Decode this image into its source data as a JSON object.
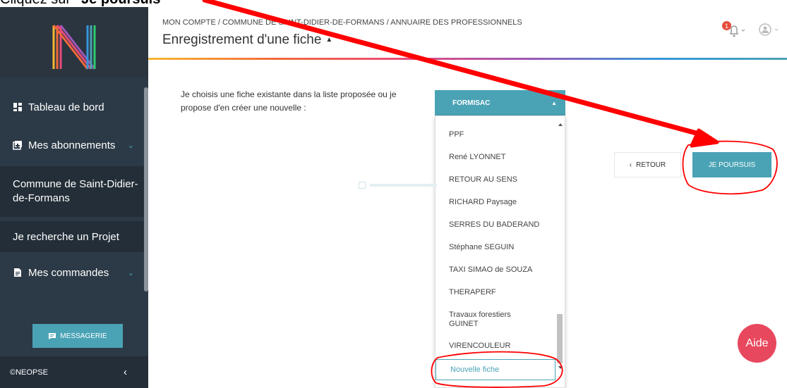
{
  "caption": {
    "prefix": "Cliquez sur ",
    "bold": "\"Je poursuis\""
  },
  "sidebar": {
    "items": [
      {
        "label": "Tableau de bord",
        "icon": "dashboard-icon"
      },
      {
        "label": "Mes abonnements",
        "icon": "subscriptions-icon"
      },
      {
        "label": "Commune de Saint-Didier-de-Formans"
      },
      {
        "label": "Je recherche un Projet"
      },
      {
        "label": "Mes commandes",
        "icon": "document-icon"
      }
    ],
    "messagerie_label": "MESSAGERIE",
    "footer_label": "©NEOPSE"
  },
  "header": {
    "breadcrumb": "MON COMPTE / COMMUNE DE SAINT-DIDIER-DE-FORMANS / ANNUAIRE DES PROFESSIONNELS",
    "title": "Enregistrement d'une fiche",
    "notification_count": "1"
  },
  "form": {
    "question": "Je choisis une fiche existante dans la liste proposée ou je propose d'en créer une nouvelle :",
    "selected_value": "FORMISAC",
    "options": [
      "PPF",
      "René LYONNET",
      "RETOUR AU SENS",
      "RICHARD Paysage",
      "SERRES DU BADERAND",
      "Stéphane SEGUIN",
      "TAXI SIMAO de SOUZA",
      "THERAPERF",
      "Travaux forestiers GUINET",
      "VIRENCOULEUR"
    ],
    "new_option": "Nouvelle fiche",
    "retour_label": "RETOUR",
    "poursuis_label": "JE POURSUIS"
  },
  "aide_label": "Aide",
  "colors": {
    "accent": "#4aa3b5",
    "sidebar": "#2c3a47",
    "annotation": "#ff0000",
    "aide": "#e8485e"
  }
}
